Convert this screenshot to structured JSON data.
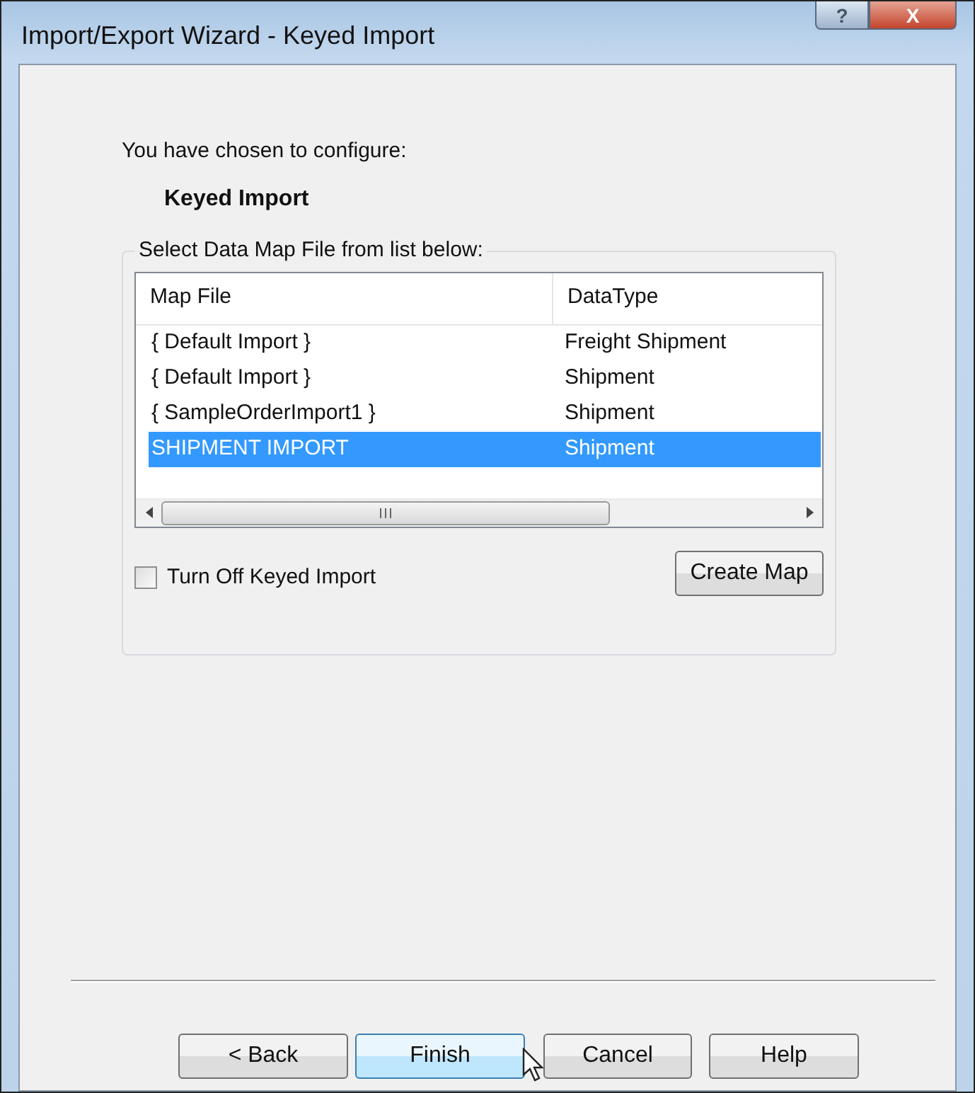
{
  "window": {
    "title": "Import/Export Wizard - Keyed Import",
    "title_buttons": [
      "?",
      "X"
    ]
  },
  "intro": "You have chosen to configure:",
  "config_name": "Keyed Import",
  "group": {
    "title": "Select Data Map File from list below:",
    "columns": [
      "Map File",
      "DataType"
    ],
    "rows": [
      {
        "map_file": "{ Default Import }",
        "data_type": "Freight Shipment",
        "selected": false
      },
      {
        "map_file": "{ Default Import }",
        "data_type": "Shipment",
        "selected": false
      },
      {
        "map_file": "{ SampleOrderImport1 }",
        "data_type": "Shipment",
        "selected": false
      },
      {
        "map_file": "SHIPMENT IMPORT",
        "data_type": "Shipment",
        "selected": true
      }
    ],
    "checkbox": {
      "label": "Turn Off Keyed Import",
      "checked": false
    },
    "create_button": "Create Map"
  },
  "buttons": [
    {
      "label": "< Back",
      "hovered": false
    },
    {
      "label": "Finish",
      "hovered": true
    },
    {
      "label": "Cancel",
      "hovered": false
    },
    {
      "label": "Help",
      "hovered": false
    }
  ]
}
